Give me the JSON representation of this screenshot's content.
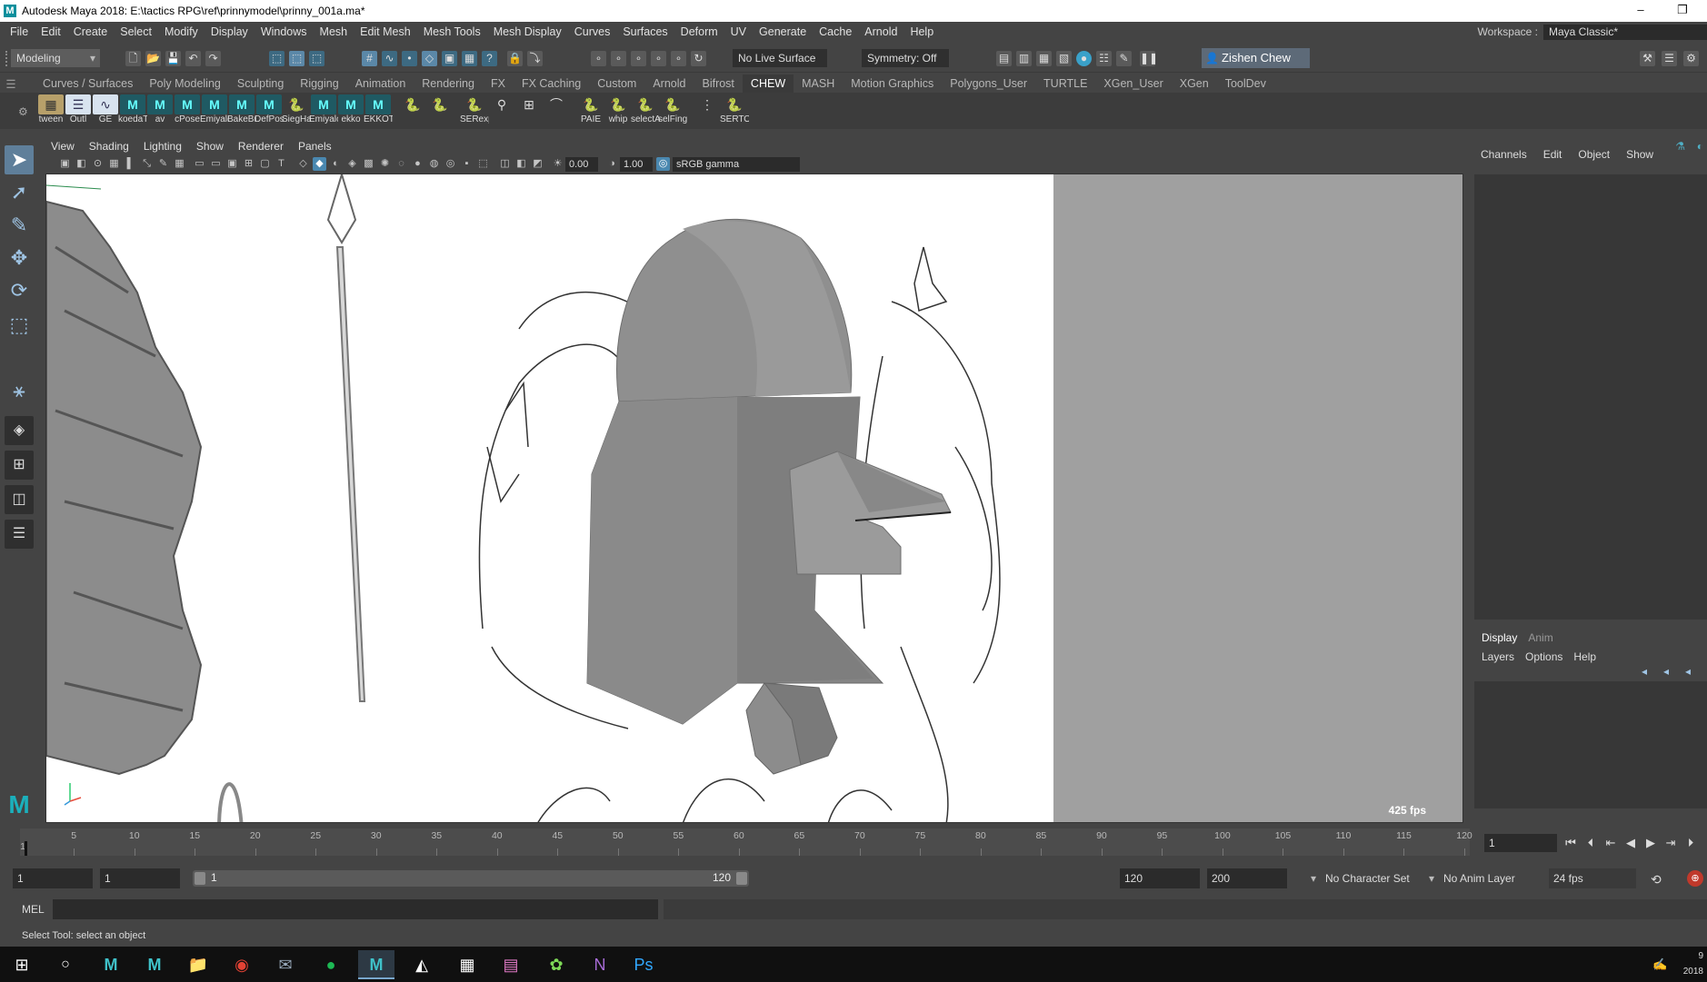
{
  "window": {
    "title": "Autodesk Maya 2018: E:\\tactics RPG\\ref\\prinnymodel\\prinny_001a.ma*",
    "minimize": "–",
    "restore": "❐"
  },
  "menubar": {
    "items": [
      "File",
      "Edit",
      "Create",
      "Select",
      "Modify",
      "Display",
      "Windows",
      "Mesh",
      "Edit Mesh",
      "Mesh Tools",
      "Mesh Display",
      "Curves",
      "Surfaces",
      "Deform",
      "UV",
      "Generate",
      "Cache",
      "Arnold",
      "Help"
    ],
    "workspace_label": "Workspace :",
    "workspace_value": "Maya Classic*"
  },
  "statusline": {
    "mode": "Modeling",
    "live_surface": "No Live Surface",
    "symmetry": "Symmetry: Off",
    "user": "Zishen Chew"
  },
  "shelf": {
    "tabs": [
      "Curves / Surfaces",
      "Poly Modeling",
      "Sculpting",
      "Rigging",
      "Animation",
      "Rendering",
      "FX",
      "FX Caching",
      "Custom",
      "Arnold",
      "Bifrost",
      "CHEW",
      "MASH",
      "Motion Graphics",
      "Polygons_User",
      "TURTLE",
      "XGen_User",
      "XGen",
      "ToolDev"
    ],
    "active_tab": "CHEW",
    "buttons": [
      {
        "label": "tween",
        "icon": "tween-icon"
      },
      {
        "label": "Outl",
        "icon": "outliner-icon"
      },
      {
        "label": "GE",
        "icon": "graph-editor-icon"
      },
      {
        "label": "koedaT",
        "icon": "maya-script-icon"
      },
      {
        "label": "av",
        "icon": "maya-script-icon"
      },
      {
        "label": "cPose",
        "icon": "maya-script-icon"
      },
      {
        "label": "Emiyalc",
        "icon": "maya-script-icon"
      },
      {
        "label": "BakeBu",
        "icon": "maya-script-icon"
      },
      {
        "label": "DefPos",
        "icon": "maya-script-icon"
      },
      {
        "label": "SiegHa",
        "icon": "python-icon"
      },
      {
        "label": "Emiyalc",
        "icon": "maya-script-icon"
      },
      {
        "label": "ekko",
        "icon": "maya-script-icon"
      },
      {
        "label": "EKKOTC",
        "icon": "maya-script-icon"
      },
      {
        "label": "",
        "icon": "python-icon"
      },
      {
        "label": "",
        "icon": "python-icon"
      },
      {
        "label": "SERexp",
        "icon": "python-icon"
      },
      {
        "label": "",
        "icon": "joint-icon"
      },
      {
        "label": "",
        "icon": "grid-icon"
      },
      {
        "label": "",
        "icon": "arc-icon"
      },
      {
        "label": "PAIE",
        "icon": "python-icon"
      },
      {
        "label": "whip",
        "icon": "python-icon"
      },
      {
        "label": "selectA",
        "icon": "python-icon"
      },
      {
        "label": "selFing",
        "icon": "python-icon"
      },
      {
        "label": "",
        "icon": "separator-icon"
      },
      {
        "label": "SERTOC",
        "icon": "python-icon"
      }
    ]
  },
  "viewport": {
    "menus": [
      "View",
      "Shading",
      "Lighting",
      "Show",
      "Renderer",
      "Panels"
    ],
    "exposure": "0.00",
    "gamma": "1.00",
    "color_space": "sRGB gamma",
    "fps": "425 fps"
  },
  "channelbox": {
    "menus": [
      "Channels",
      "Edit",
      "Object",
      "Show"
    ]
  },
  "layereditor": {
    "tabs": [
      "Display",
      "Anim"
    ],
    "menus": [
      "Layers",
      "Options",
      "Help"
    ]
  },
  "timeslider": {
    "ticks": [
      "5",
      "10",
      "15",
      "20",
      "25",
      "30",
      "35",
      "40",
      "45",
      "50",
      "55",
      "60",
      "65",
      "70",
      "75",
      "80",
      "85",
      "90",
      "95",
      "100",
      "105",
      "110",
      "115",
      "120"
    ],
    "first_tick": "1",
    "range_start": 1,
    "range_end": 120,
    "current_frame": "1"
  },
  "rangeslider": {
    "start": "1",
    "playback_start": "1",
    "slider_start": "1",
    "slider_end": "120",
    "playback_end": "120",
    "end": "200",
    "character_set": "No Character Set",
    "anim_layer": "No Anim Layer",
    "fps": "24 fps"
  },
  "cmdline": {
    "lang": "MEL"
  },
  "helpline": {
    "text": "Select Tool: select an object"
  },
  "taskbar": {
    "clock_line1": "9",
    "clock_line2": "2018"
  },
  "colors": {
    "ui_bg": "#444444",
    "viewport_bg": "#a0a0a0",
    "accent": "#5b88a8"
  }
}
